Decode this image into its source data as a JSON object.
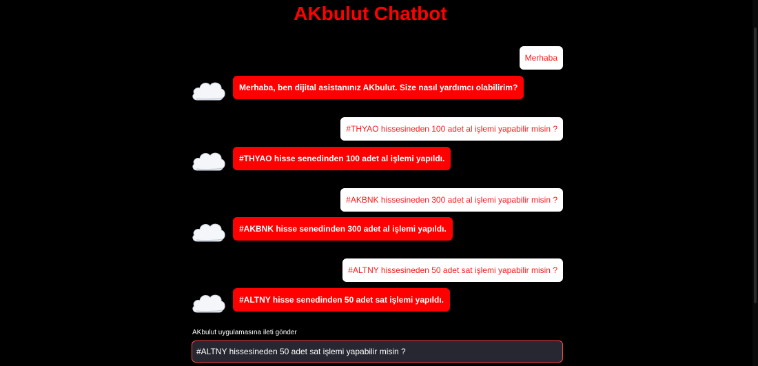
{
  "header": {
    "title": "AKbulut Chatbot"
  },
  "messages": [
    {
      "role": "user",
      "text": "Merhaba"
    },
    {
      "role": "bot",
      "text": "Merhaba, ben dijital asistanınız AKbulut. Size nasıl yardımcı olabilirim?"
    },
    {
      "role": "user",
      "text": "#THYAO hissesineden 100 adet al işlemi yapabilir misin ?"
    },
    {
      "role": "bot",
      "text": "#THYAO hisse senedinden 100 adet al işlemi yapıldı."
    },
    {
      "role": "user",
      "text": "#AKBNK hissesineden 300 adet al işlemi yapabilir misin ?"
    },
    {
      "role": "bot",
      "text": "#AKBNK hisse senedinden 300 adet al işlemi yapıldı."
    },
    {
      "role": "user",
      "text": "#ALTNY hissesineden 50 adet sat işlemi yapabilir misin ?"
    },
    {
      "role": "bot",
      "text": "#ALTNY hisse senedinden 50 adet sat işlemi yapıldı."
    }
  ],
  "bot_avatar_icon": "cloud-icon",
  "input": {
    "label": "AKbulut uygulamasına ileti gönder",
    "value": "#ALTNY hissesineden 50 adet sat işlemi yapabilir misin ?"
  },
  "colors": {
    "accent": "#ff0000",
    "background": "#000000",
    "user_bubble": "#ffffff",
    "input_bg": "#262730",
    "input_border": "#ff4b4b"
  }
}
